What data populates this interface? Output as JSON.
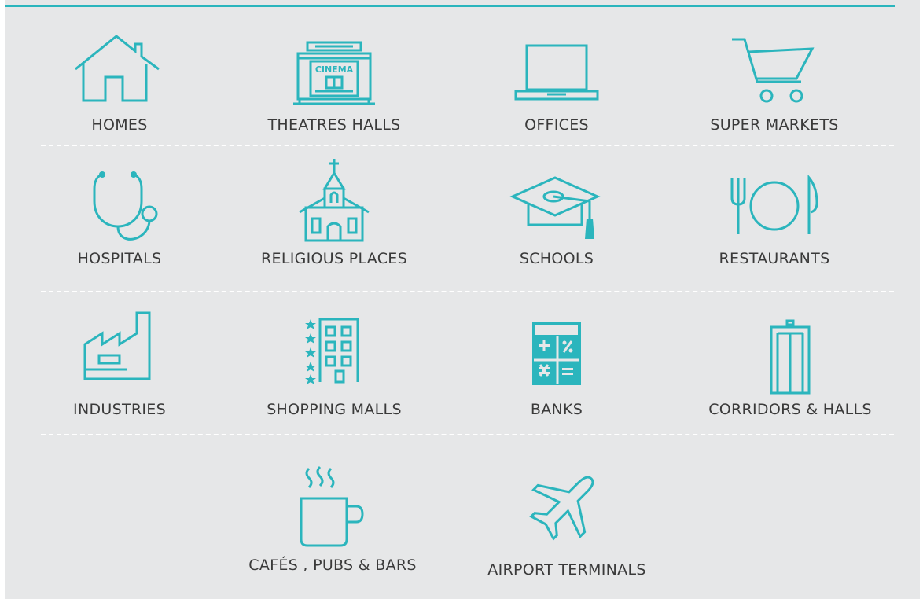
{
  "accent_color": "#2bb5bd",
  "categories": [
    {
      "id": "homes",
      "label": "HOMES",
      "icon": "house-icon"
    },
    {
      "id": "theatres",
      "label": "THEATRES HALLS",
      "icon": "cinema-icon",
      "icon_text": "CINEMA"
    },
    {
      "id": "offices",
      "label": "OFFICES",
      "icon": "laptop-icon"
    },
    {
      "id": "supermarkets",
      "label": "SUPER  MARKETS",
      "icon": "shopping-cart-icon"
    },
    {
      "id": "hospitals",
      "label": "HOSPITALS",
      "icon": "stethoscope-icon"
    },
    {
      "id": "religious",
      "label": "RELIGIOUS PLACES",
      "icon": "church-icon"
    },
    {
      "id": "schools",
      "label": "SCHOOLS",
      "icon": "graduation-cap-icon"
    },
    {
      "id": "restaurants",
      "label": "RESTAURANTS",
      "icon": "cutlery-plate-icon"
    },
    {
      "id": "industries",
      "label": "INDUSTRIES",
      "icon": "factory-icon"
    },
    {
      "id": "shopping_malls",
      "label": "SHOPPING MALLS",
      "icon": "hotel-building-icon"
    },
    {
      "id": "banks",
      "label": "BANKS",
      "icon": "calculator-icon"
    },
    {
      "id": "corridors",
      "label": "CORRIDORS & HALLS",
      "icon": "elevator-icon"
    },
    {
      "id": "cafes",
      "label": "CAFÉS , PUBS & BARS",
      "icon": "coffee-cup-icon"
    },
    {
      "id": "airports",
      "label": "AIRPORT  TERMINALS",
      "icon": "airplane-icon"
    }
  ]
}
